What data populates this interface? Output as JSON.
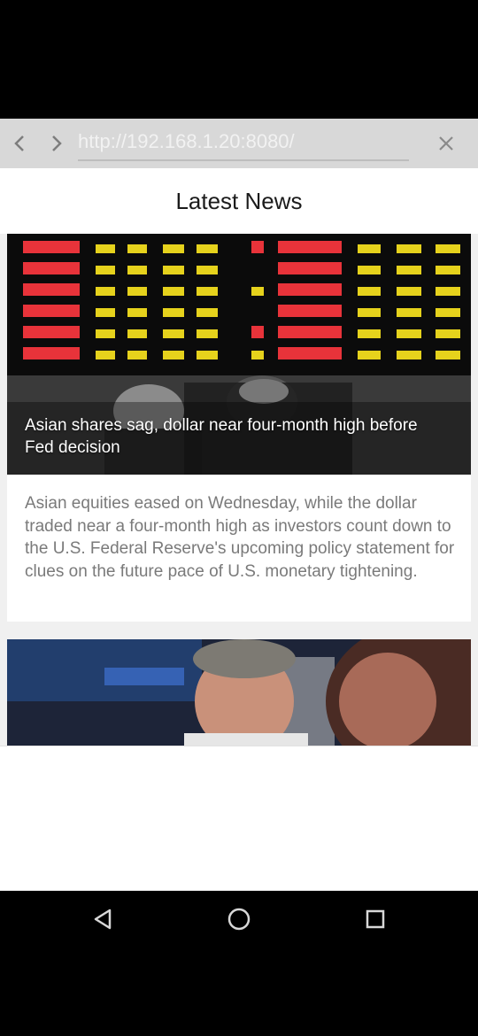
{
  "browser": {
    "url": "http://192.168.1.20:8080/",
    "back_icon": "chevron-left-icon",
    "forward_icon": "chevron-right-icon",
    "close_icon": "close-icon"
  },
  "page": {
    "title": "Latest News"
  },
  "articles": [
    {
      "headline": "Asian shares sag, dollar near four-month high before Fed decision",
      "summary": "Asian equities eased on Wednesday, while the dollar traded near a four-month high as investors count down to the U.S. Federal Reserve's upcoming policy statement for clues on the future pace of U.S. monetary tightening.",
      "image": "stock-board-traders-photo"
    },
    {
      "image": "trader-portrait-photo"
    }
  ],
  "system_nav": {
    "back_icon": "triangle-back-icon",
    "home_icon": "circle-home-icon",
    "recents_icon": "square-recents-icon"
  },
  "colors": {
    "browser_bar": "#d8d8d8",
    "board_red": "#e8333a",
    "board_yellow": "#e6d21c"
  }
}
